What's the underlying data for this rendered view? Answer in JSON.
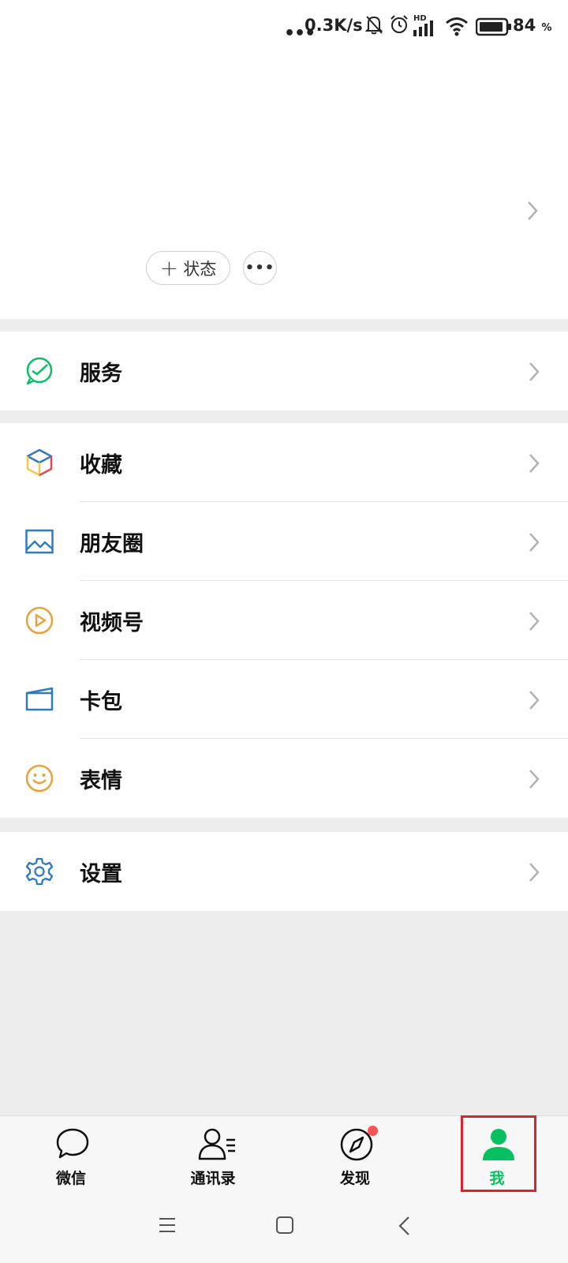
{
  "status_bar": {
    "signal_dots": "•••",
    "net_speed": "0.3K/s",
    "hd_label": "HD",
    "battery_percent": "84",
    "battery_unit": "%",
    "icons": [
      "mute-bell-icon",
      "alarm-icon",
      "signal-icon",
      "wifi-icon",
      "battery-icon"
    ]
  },
  "profile": {
    "status_button": {
      "icon": "plus-icon",
      "label": "状态"
    },
    "more_button": {
      "label": "•••"
    }
  },
  "menu_groups": [
    [
      {
        "label": "服务",
        "icon": "service-wallet-icon",
        "color": "#07c160"
      }
    ],
    [
      {
        "label": "收藏",
        "icon": "favorites-cube-icon",
        "color": "#f2c94c"
      },
      {
        "label": "朋友圈",
        "icon": "moments-photo-icon",
        "color": "#2f7ac0"
      },
      {
        "label": "视频号",
        "icon": "channels-play-icon",
        "color": "#e9a23b"
      },
      {
        "label": "卡包",
        "icon": "card-wallet-icon",
        "color": "#2f7ac0"
      },
      {
        "label": "表情",
        "icon": "sticker-smile-icon",
        "color": "#e9a23b"
      }
    ],
    [
      {
        "label": "设置",
        "icon": "settings-gear-icon",
        "color": "#2f7ac0"
      }
    ]
  ],
  "tab_bar": {
    "tabs": [
      {
        "label": "微信",
        "icon": "chat-bubble-icon",
        "active": false
      },
      {
        "label": "通讯录",
        "icon": "contacts-icon",
        "active": false
      },
      {
        "label": "发现",
        "icon": "compass-icon",
        "active": false,
        "badge": true
      },
      {
        "label": "我",
        "icon": "person-icon",
        "active": true
      }
    ],
    "active_color": "#07c160",
    "badge_color": "#fa5151"
  },
  "system_nav": [
    "menu-icon",
    "home-square-icon",
    "back-icon"
  ]
}
